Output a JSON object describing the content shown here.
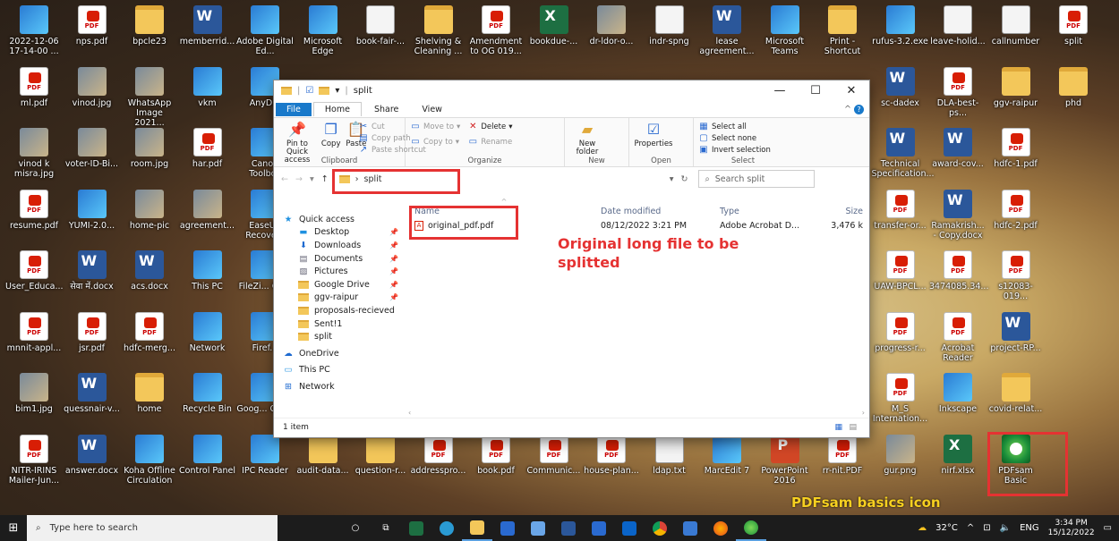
{
  "desktop_icons": [
    {
      "label": "2022-12-06 17-14-00 ...",
      "kind": "app",
      "col": 0,
      "row": 0
    },
    {
      "label": "nps.pdf",
      "kind": "pdf",
      "col": 1,
      "row": 0
    },
    {
      "label": "bpcle23",
      "kind": "folder",
      "col": 2,
      "row": 0
    },
    {
      "label": "memberrid...",
      "kind": "word",
      "col": 3,
      "row": 0
    },
    {
      "label": "Adobe Digital Ed...",
      "kind": "app",
      "col": 4,
      "row": 0
    },
    {
      "label": "Microsoft Edge",
      "kind": "app",
      "col": 5,
      "row": 0
    },
    {
      "label": "book-fair-...",
      "kind": "txt",
      "col": 6,
      "row": 0
    },
    {
      "label": "Shelving & Cleaning ...",
      "kind": "folder",
      "col": 7,
      "row": 0
    },
    {
      "label": "Amendment to OG 019...",
      "kind": "pdf",
      "col": 8,
      "row": 0
    },
    {
      "label": "bookdue-...",
      "kind": "excel",
      "col": 9,
      "row": 0
    },
    {
      "label": "dr-ldor-o...",
      "kind": "photo",
      "col": 10,
      "row": 0
    },
    {
      "label": "indr-spng",
      "kind": "txt",
      "col": 11,
      "row": 0
    },
    {
      "label": "lease agreement...",
      "kind": "word",
      "col": 12,
      "row": 0
    },
    {
      "label": "Microsoft Teams",
      "kind": "app",
      "col": 13,
      "row": 0
    },
    {
      "label": "Print - Shortcut",
      "kind": "folder",
      "col": 14,
      "row": 0
    },
    {
      "label": "rufus-3.2.exe",
      "kind": "app",
      "col": 15,
      "row": 0
    },
    {
      "label": "leave-holid...",
      "kind": "txt",
      "col": 16,
      "row": 0
    },
    {
      "label": "callnumber",
      "kind": "txt",
      "col": 17,
      "row": 0
    },
    {
      "label": "split",
      "kind": "pdf",
      "col": 18,
      "row": 0
    },
    {
      "label": "ml.pdf",
      "kind": "pdf",
      "col": 0,
      "row": 1
    },
    {
      "label": "vinod.jpg",
      "kind": "photo",
      "col": 1,
      "row": 1
    },
    {
      "label": "WhatsApp Image 2021...",
      "kind": "photo",
      "col": 2,
      "row": 1
    },
    {
      "label": "vkm",
      "kind": "app",
      "col": 3,
      "row": 1
    },
    {
      "label": "AnyD...",
      "kind": "app",
      "col": 4,
      "row": 1
    },
    {
      "label": "sc-dadex",
      "kind": "word",
      "col": 15,
      "row": 1
    },
    {
      "label": "DLA-best-ps...",
      "kind": "pdf",
      "col": 16,
      "row": 1
    },
    {
      "label": "ggv-raipur",
      "kind": "folder",
      "col": 17,
      "row": 1
    },
    {
      "label": "phd",
      "kind": "folder",
      "col": 18,
      "row": 1
    },
    {
      "label": "vinod k misra.jpg",
      "kind": "photo",
      "col": 0,
      "row": 2
    },
    {
      "label": "voter-ID-Bi...",
      "kind": "photo",
      "col": 1,
      "row": 2
    },
    {
      "label": "room.jpg",
      "kind": "photo",
      "col": 2,
      "row": 2
    },
    {
      "label": "har.pdf",
      "kind": "pdf",
      "col": 3,
      "row": 2
    },
    {
      "label": "Canon Toolbox",
      "kind": "app",
      "col": 4,
      "row": 2
    },
    {
      "label": "Technical Specification...",
      "kind": "word",
      "col": 15,
      "row": 2
    },
    {
      "label": "award-cov...",
      "kind": "word",
      "col": 16,
      "row": 2
    },
    {
      "label": "hdfc-1.pdf",
      "kind": "pdf",
      "col": 17,
      "row": 2
    },
    {
      "label": "resume.pdf",
      "kind": "pdf",
      "col": 0,
      "row": 3
    },
    {
      "label": "YUMI-2.0...",
      "kind": "app",
      "col": 1,
      "row": 3
    },
    {
      "label": "home-pic",
      "kind": "photo",
      "col": 2,
      "row": 3
    },
    {
      "label": "agreement...",
      "kind": "photo",
      "col": 3,
      "row": 3
    },
    {
      "label": "EaseUS Recove...",
      "kind": "app",
      "col": 4,
      "row": 3
    },
    {
      "label": "transfer-or...",
      "kind": "pdf",
      "col": 15,
      "row": 3
    },
    {
      "label": "Ramakrish... - Copy.docx",
      "kind": "word",
      "col": 16,
      "row": 3
    },
    {
      "label": "hdfc-2.pdf",
      "kind": "pdf",
      "col": 17,
      "row": 3
    },
    {
      "label": "User_Educa...",
      "kind": "pdf",
      "col": 0,
      "row": 4
    },
    {
      "label": "सेवा में.docx",
      "kind": "word",
      "col": 1,
      "row": 4
    },
    {
      "label": "acs.docx",
      "kind": "word",
      "col": 2,
      "row": 4
    },
    {
      "label": "This PC",
      "kind": "app",
      "col": 3,
      "row": 4
    },
    {
      "label": "FileZi... Clier",
      "kind": "app",
      "col": 4,
      "row": 4
    },
    {
      "label": "UAW-BPCL...",
      "kind": "pdf",
      "col": 15,
      "row": 4
    },
    {
      "label": "3474085.34...",
      "kind": "pdf",
      "col": 16,
      "row": 4
    },
    {
      "label": "s12083-019...",
      "kind": "pdf",
      "col": 17,
      "row": 4
    },
    {
      "label": "mnnit-appl...",
      "kind": "pdf",
      "col": 0,
      "row": 5
    },
    {
      "label": "jsr.pdf",
      "kind": "pdf",
      "col": 1,
      "row": 5
    },
    {
      "label": "hdfc-merg...",
      "kind": "pdf",
      "col": 2,
      "row": 5
    },
    {
      "label": "Network",
      "kind": "app",
      "col": 3,
      "row": 5
    },
    {
      "label": "Firef...",
      "kind": "app",
      "col": 4,
      "row": 5
    },
    {
      "label": "progress-r...",
      "kind": "pdf",
      "col": 15,
      "row": 5
    },
    {
      "label": "Acrobat Reader",
      "kind": "pdf",
      "col": 16,
      "row": 5
    },
    {
      "label": "project-RP...",
      "kind": "word",
      "col": 17,
      "row": 5
    },
    {
      "label": "bim1.jpg",
      "kind": "photo",
      "col": 0,
      "row": 6
    },
    {
      "label": "quessnair-v...",
      "kind": "word",
      "col": 1,
      "row": 6
    },
    {
      "label": "home",
      "kind": "folder",
      "col": 2,
      "row": 6
    },
    {
      "label": "Recycle Bin",
      "kind": "app",
      "col": 3,
      "row": 6
    },
    {
      "label": "Goog... Chror",
      "kind": "app",
      "col": 4,
      "row": 6
    },
    {
      "label": "M_S Internation...",
      "kind": "pdf",
      "col": 15,
      "row": 6
    },
    {
      "label": "Inkscape",
      "kind": "app",
      "col": 16,
      "row": 6
    },
    {
      "label": "covid-relat...",
      "kind": "folder",
      "col": 17,
      "row": 6
    },
    {
      "label": "NITR-IRINS Mailer-Jun...",
      "kind": "pdf",
      "col": 0,
      "row": 7
    },
    {
      "label": "answer.docx",
      "kind": "word",
      "col": 1,
      "row": 7
    },
    {
      "label": "Koha Offline Circulation",
      "kind": "app",
      "col": 2,
      "row": 7
    },
    {
      "label": "Control Panel",
      "kind": "app",
      "col": 3,
      "row": 7
    },
    {
      "label": "IPC Reader",
      "kind": "app",
      "col": 4,
      "row": 7
    },
    {
      "label": "audit-data...",
      "kind": "folder",
      "col": 5,
      "row": 7
    },
    {
      "label": "question-r...",
      "kind": "folder",
      "col": 6,
      "row": 7
    },
    {
      "label": "addresspro...",
      "kind": "pdf",
      "col": 7,
      "row": 7
    },
    {
      "label": "book.pdf",
      "kind": "pdf",
      "col": 8,
      "row": 7
    },
    {
      "label": "Communic...",
      "kind": "pdf",
      "col": 9,
      "row": 7
    },
    {
      "label": "house-plan...",
      "kind": "pdf",
      "col": 10,
      "row": 7
    },
    {
      "label": "ldap.txt",
      "kind": "txt",
      "col": 11,
      "row": 7
    },
    {
      "label": "MarcEdit 7",
      "kind": "app",
      "col": 12,
      "row": 7
    },
    {
      "label": "PowerPoint 2016",
      "kind": "ppt",
      "col": 13,
      "row": 7
    },
    {
      "label": "rr-nit.PDF",
      "kind": "pdf",
      "col": 14,
      "row": 7
    },
    {
      "label": "gur.png",
      "kind": "photo",
      "col": 15,
      "row": 7
    },
    {
      "label": "nirf.xlsx",
      "kind": "excel",
      "col": 16,
      "row": 7
    },
    {
      "label": "PDFsam Basic",
      "kind": "pdfsam",
      "col": 17,
      "row": 7
    }
  ],
  "explorer": {
    "title": "split",
    "tabs": [
      "File",
      "Home",
      "Share",
      "View"
    ],
    "ribbon": {
      "pin": "Pin to Quick access",
      "copy": "Copy",
      "paste": "Paste",
      "cut": "Cut",
      "copy_path": "Copy path",
      "paste_shortcut": "Paste shortcut",
      "clipboard": "Clipboard",
      "move_to": "Move to",
      "copy_to": "Copy to",
      "delete": "Delete",
      "rename": "Rename",
      "organize": "Organize",
      "new_folder": "New folder",
      "new": "New",
      "properties": "Properties",
      "open": "Open",
      "select_all": "Select all",
      "select_none": "Select none",
      "invert_selection": "Invert selection",
      "select": "Select"
    },
    "address": "split",
    "search_placeholder": "Search split",
    "nav": [
      {
        "label": "Quick access",
        "lvl": 0,
        "icon": "star",
        "pin": false
      },
      {
        "label": "Desktop",
        "lvl": 1,
        "icon": "desktop",
        "pin": true
      },
      {
        "label": "Downloads",
        "lvl": 1,
        "icon": "download",
        "pin": true
      },
      {
        "label": "Documents",
        "lvl": 1,
        "icon": "doc",
        "pin": true
      },
      {
        "label": "Pictures",
        "lvl": 1,
        "icon": "pic",
        "pin": true
      },
      {
        "label": "Google Drive",
        "lvl": 1,
        "icon": "folder",
        "pin": true
      },
      {
        "label": "ggv-raipur",
        "lvl": 1,
        "icon": "folder",
        "pin": true
      },
      {
        "label": "proposals-recieved",
        "lvl": 1,
        "icon": "folder",
        "pin": false
      },
      {
        "label": "Sent!1",
        "lvl": 1,
        "icon": "folder",
        "pin": false
      },
      {
        "label": "split",
        "lvl": 1,
        "icon": "folder",
        "pin": false
      },
      {
        "label": "OneDrive",
        "lvl": 0,
        "icon": "cloud",
        "pin": false
      },
      {
        "label": "This PC",
        "lvl": 0,
        "icon": "pc",
        "pin": false
      },
      {
        "label": "Network",
        "lvl": 0,
        "icon": "net",
        "pin": false
      }
    ],
    "columns": {
      "name": "Name",
      "date": "Date modified",
      "type": "Type",
      "size": "Size"
    },
    "file": {
      "name": "original_pdf.pdf",
      "date": "08/12/2022 3:21 PM",
      "type": "Adobe Acrobat D...",
      "size": "3,476 k"
    },
    "status": "1 item"
  },
  "annotations": {
    "original": "Original long file to be splitted",
    "pdfsam": "PDFsam basics icon",
    "color": "#e53232",
    "yellow": "#f7d020"
  },
  "taskbar": {
    "search_placeholder": "Type here to search",
    "temperature": "32°C",
    "language": "ENG",
    "time": "3:34 PM",
    "date": "15/12/2022"
  }
}
